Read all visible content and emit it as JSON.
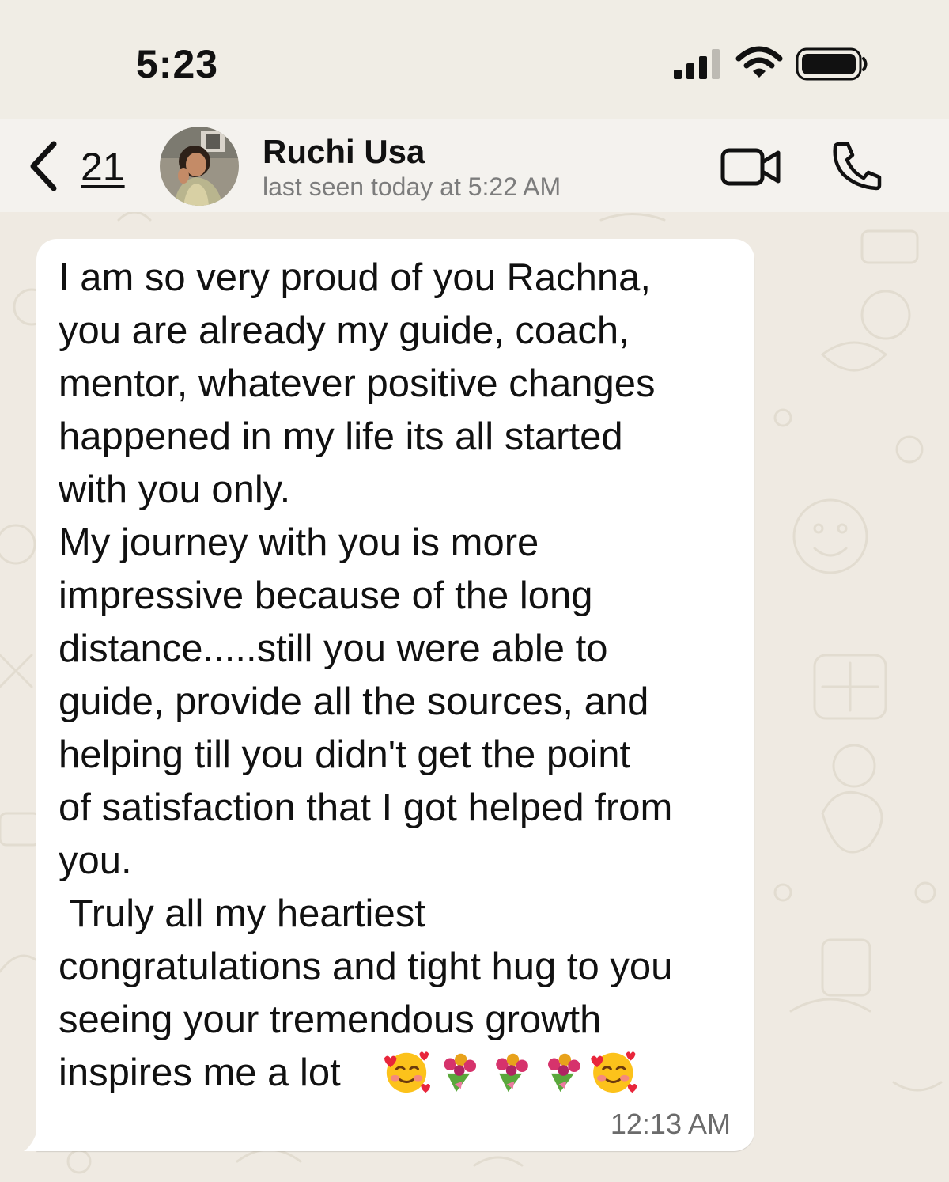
{
  "status_bar": {
    "time": "5:23",
    "signal_icon": "cellular-signal-icon",
    "wifi_icon": "wifi-icon",
    "battery_icon": "battery-icon"
  },
  "header": {
    "back_icon": "chevron-left-icon",
    "unread_count": "21",
    "contact_name": "Ruchi Usa",
    "contact_status": "last seen today at 5:22 AM",
    "video_call_icon": "video-camera-icon",
    "voice_call_icon": "phone-icon"
  },
  "message": {
    "text": "I am so very proud of you Rachna,\nyou are already my guide, coach,\nmentor, whatever positive changes\nhappened in my life its all started\nwith you only.\nMy journey with you is more\nimpressive because of the long\ndistance.....still you were able to\nguide, provide all the sources, and\nhelping till you didn't get the point\nof satisfaction that I got helped from\nyou.\n Truly all my heartiest\ncongratulations and tight hug to you\nseeing your tremendous growth\ninspires me a lot",
    "emojis": [
      "smiling-face-with-hearts",
      "bouquet",
      "bouquet",
      "bouquet",
      "smiling-face-with-hearts"
    ],
    "time": "12:13 AM"
  },
  "colors": {
    "background": "#efeae2",
    "bubble": "#ffffff",
    "secondary_text": "#7c7c7c"
  }
}
